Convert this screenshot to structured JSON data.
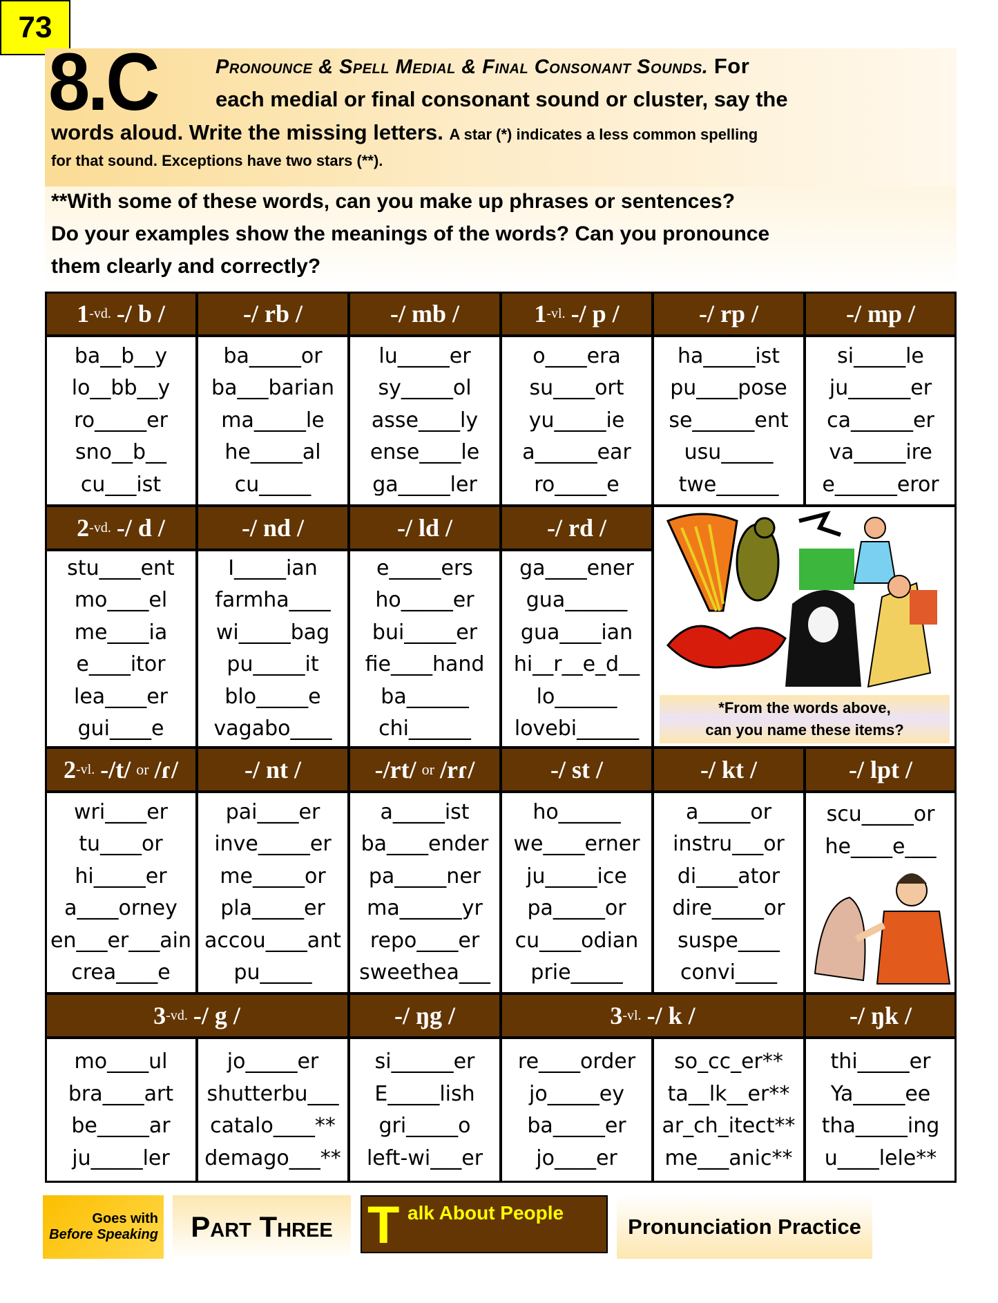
{
  "header": {
    "section_number": "8.C",
    "title": "Pronounce & Spell Medial & Final Consonant Sounds.",
    "title_tail": "For",
    "instruction_line2": "each medial or final consonant sound or cluster, say the",
    "instruction_line3_bold": "words aloud. Write the missing letters.",
    "instruction_line3_small": "A star (*) indicates a less common spelling",
    "instruction_line4": "for that sound. Exceptions have two stars (**).",
    "question_lines": [
      "**With some of these words, can you make up phrases or sentences?",
      "Do your examples show the meanings of the words? Can you pronounce",
      "them clearly and correctly?"
    ]
  },
  "sections": [
    {
      "headers": [
        {
          "num": "1",
          "tag": "-vd.",
          "sound": "-/ b /"
        },
        {
          "sound": "-/ rb /"
        },
        {
          "sound": "-/ mb /"
        },
        {
          "num": "1",
          "tag": "-vl.",
          "sound": "-/ p /"
        },
        {
          "sound": "-/ rp /"
        },
        {
          "sound": "-/ mp /"
        }
      ],
      "columns": [
        [
          "ba__b__y",
          "lo__bb__y",
          "ro_____er",
          "sno__b__",
          "cu___ist"
        ],
        [
          "ba_____or",
          "ba___barian",
          "ma_____le",
          "he_____al",
          "cu_____"
        ],
        [
          "lu_____er",
          "sy_____ol",
          "asse____ly",
          "ense____le",
          "ga_____ler"
        ],
        [
          "o____era",
          "su____ort",
          "yu_____ie",
          "a______ear",
          "ro_____e"
        ],
        [
          "ha_____ist",
          "pu____pose",
          "se______ent",
          "usu_____",
          "twe______"
        ],
        [
          "si_____le",
          "ju______er",
          "ca______er",
          "va_____ire",
          "e______eror"
        ]
      ]
    },
    {
      "headers": [
        {
          "num": "2",
          "tag": "-vd.",
          "sound": "-/ d /"
        },
        {
          "sound": "-/ nd /"
        },
        {
          "sound": "-/ ld /"
        },
        {
          "sound": "-/ rd /"
        }
      ],
      "columns": [
        [
          "stu____ent",
          "mo____el",
          "me____ia",
          "e____itor",
          "lea____er",
          "gui____e"
        ],
        [
          "I_____ian",
          "farmha____",
          "wi_____bag",
          "pu_____it",
          "blo_____e",
          "vagabo____"
        ],
        [
          "e_____ers",
          "ho_____er",
          "bui_____er",
          "fie____hand",
          "ba______",
          "chi______"
        ],
        [
          "ga____ener",
          "gua______",
          "gua____ian",
          "hi__r__e_d__",
          "lo______",
          "lovebi______"
        ]
      ],
      "picture_caption": [
        "*From the words above,",
        "can you name these items?"
      ]
    },
    {
      "headers": [
        {
          "num": "2",
          "tag": "-vl.",
          "sound": "-/t/",
          "alt": "/ɾ/"
        },
        {
          "sound": "-/ nt /"
        },
        {
          "sound": "-/rt/",
          "alt": "/rɾ/"
        },
        {
          "sound": "-/ st /"
        },
        {
          "sound": "-/ kt /"
        },
        {
          "sound": "-/ lpt /"
        }
      ],
      "columns": [
        [
          "wri____er",
          "tu____or",
          "hi_____er",
          "a____orney",
          "en___er___ain",
          "crea____e"
        ],
        [
          "pai____er",
          "inve_____er",
          "me_____or",
          "pla_____er",
          "accou____ant",
          "pu_____"
        ],
        [
          "a_____ist",
          "ba____ender",
          "pa_____ner",
          "ma______yr",
          "repo____er",
          "sweethea___"
        ],
        [
          "ho______",
          "we____erner",
          "ju_____ice",
          "pa_____or",
          "cu____odian",
          "prie_____"
        ],
        [
          "a_____or",
          "instru___or",
          "di____ator",
          "dire_____or",
          "suspe____",
          "convi____"
        ],
        [
          "scu_____or",
          "he____e___"
        ]
      ]
    },
    {
      "headers": [
        {
          "num": "3",
          "tag": "-vd.",
          "sound": "-/ g /",
          "span": 2
        },
        {
          "sound": "-/ ŋg /"
        },
        {
          "num": "3",
          "tag": "-vl.",
          "sound": "-/ k /",
          "span": 2
        },
        {
          "sound": "-/ ŋk /"
        }
      ],
      "columns": [
        [
          "mo____ul",
          "bra____art",
          "be_____ar",
          "ju_____ler"
        ],
        [
          "jo_____er",
          "shutterbu___",
          "catalo____**",
          "demago___**"
        ],
        [
          "si______er",
          "E_____lish",
          "gri_____o",
          "left-wi___er"
        ],
        [
          "re____order",
          "jo_____ey",
          "ba_____er",
          "jo____er"
        ],
        [
          "so_cc_er**",
          "ta__lk__er**",
          "ar_ch_itect**",
          "me___anic**"
        ],
        [
          "thi_____er",
          "Ya_____ee",
          "tha_____ing",
          "u____lele**"
        ]
      ]
    }
  ],
  "footer": {
    "goes_with": "Goes with",
    "book": "Before Speaking",
    "part": "Part Three",
    "unit_initial": "T",
    "unit_rest": "alk About People",
    "subject": "Pronunciation Practice",
    "page_number": "73"
  }
}
